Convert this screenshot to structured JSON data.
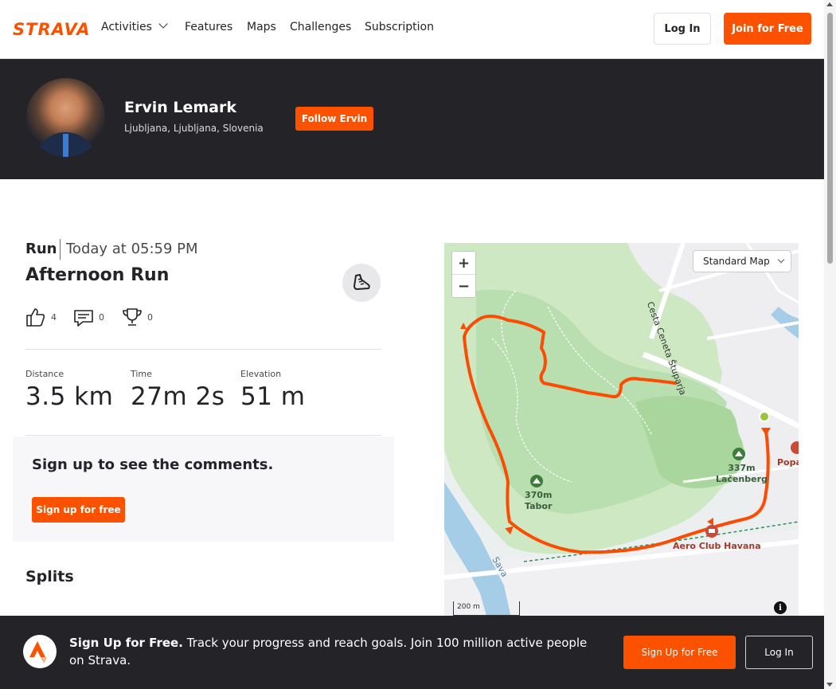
{
  "nav": {
    "logo": "STRAVA",
    "items": [
      "Activities",
      "Features",
      "Maps",
      "Challenges",
      "Subscription"
    ],
    "login_label": "Log In",
    "join_label": "Join for Free"
  },
  "profile": {
    "name": "Ervin Lemark",
    "location": "Ljubljana, Ljubljana, Slovenia",
    "follow_label": "Follow Ervin"
  },
  "activity": {
    "type": "Run",
    "date": "Today at 05:59 PM",
    "title": "Afternoon Run",
    "kudos": "4",
    "comments": "0",
    "achievements": "0",
    "stats": [
      {
        "label": "Distance",
        "value": "3.5 km"
      },
      {
        "label": "Time",
        "value": "27m 2s"
      },
      {
        "label": "Elevation",
        "value": "51 m"
      }
    ]
  },
  "comments": {
    "title": "Sign up to see the comments.",
    "button_label": "Sign up for free"
  },
  "splits": {
    "title": "Splits"
  },
  "map": {
    "style_label": "Standard Map",
    "zoom_in": "+",
    "zoom_out": "−",
    "scale_label": "200 m",
    "info": "i",
    "labels": {
      "street": "Cesta Ceneta Štuparja",
      "peak1_elev": "370m",
      "peak1_name": "Tabor",
      "peak2_elev": "337m",
      "peak2_name": "Lačenberg",
      "poi": "Aero Club Havana",
      "poi2": "Popa",
      "river": "Sava"
    }
  },
  "banner": {
    "lead": "Sign Up for Free.",
    "text": "Track your progress and reach goals. Join 100 million active people on Strava.",
    "signup_label": "Sign Up for Free",
    "login_label": "Log In"
  },
  "colors": {
    "brand": "#fc5200",
    "dark": "#242428"
  }
}
